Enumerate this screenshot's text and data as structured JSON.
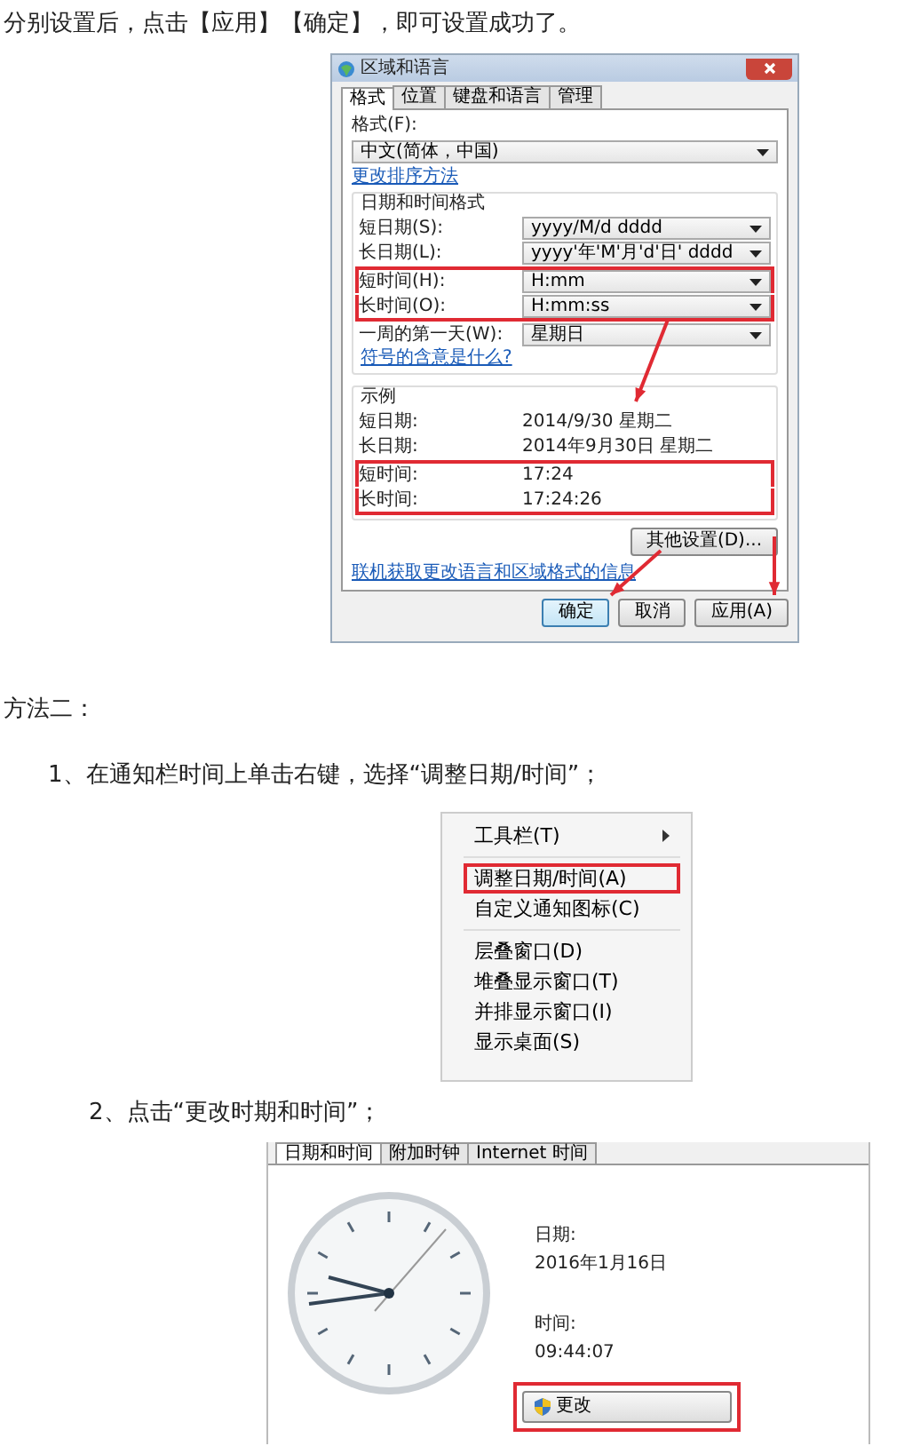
{
  "intro": "分别设置后，点击【应用】【确定】，即可设置成功了。",
  "region_dialog": {
    "title": "区域和语言",
    "tabs": [
      {
        "label": "格式",
        "selected": true
      },
      {
        "label": "位置",
        "selected": false
      },
      {
        "label": "键盘和语言",
        "selected": false
      },
      {
        "label": "管理",
        "selected": false
      }
    ],
    "format_label": "格式(F):",
    "format_value": "中文(简体，中国)",
    "sort_link": "更改排序方法",
    "datetime_group": {
      "title": "日期和时间格式",
      "rows": [
        {
          "label": "短日期(S):",
          "value": "yyyy/M/d dddd",
          "highlighted": false
        },
        {
          "label": "长日期(L):",
          "value": "yyyy'年'M'月'd'日' dddd",
          "highlighted": false
        },
        {
          "label": "短时间(H):",
          "value": "H:mm",
          "highlighted": true
        },
        {
          "label": "长时间(O):",
          "value": "H:mm:ss",
          "highlighted": true
        },
        {
          "label": "一周的第一天(W):",
          "value": "星期日",
          "highlighted": false
        }
      ]
    },
    "symbols_link": "符号的含意是什么?",
    "example_group": {
      "title": "示例",
      "rows": [
        {
          "label": "短日期:",
          "value": "2014/9/30 星期二",
          "highlighted": false
        },
        {
          "label": "长日期:",
          "value": "2014年9月30日 星期二",
          "highlighted": false
        },
        {
          "label": "短时间:",
          "value": "17:24",
          "highlighted": true
        },
        {
          "label": "长时间:",
          "value": "17:24:26",
          "highlighted": true
        }
      ]
    },
    "other_settings_button": "其他设置(D)...",
    "online_link": "联机获取更改语言和区域格式的信息",
    "buttons": [
      {
        "label": "确定",
        "default": true
      },
      {
        "label": "取消",
        "default": false
      },
      {
        "label": "应用(A)",
        "default": false
      }
    ]
  },
  "method_heading": "方法二：",
  "step_1": "1、在通知栏时间上单击右键，选择“调整日期/时间”；",
  "context_menu": {
    "items": [
      {
        "label": "工具栏(T)",
        "submenu": true,
        "highlighted": false,
        "separator_before": false
      },
      {
        "label": "调整日期/时间(A)",
        "submenu": false,
        "highlighted": true,
        "separator_before": true
      },
      {
        "label": "自定义通知图标(C)",
        "submenu": false,
        "highlighted": false,
        "separator_before": false
      },
      {
        "label": "层叠窗口(D)",
        "submenu": false,
        "highlighted": false,
        "separator_before": true
      },
      {
        "label": "堆叠显示窗口(T)",
        "submenu": false,
        "highlighted": false,
        "separator_before": false
      },
      {
        "label": "并排显示窗口(I)",
        "submenu": false,
        "highlighted": false,
        "separator_before": false
      },
      {
        "label": "显示桌面(S)",
        "submenu": false,
        "highlighted": false,
        "separator_before": false
      }
    ]
  },
  "step_2": "2、点击“更改时期和时间”；",
  "clock_dialog": {
    "tabs": [
      {
        "label": "日期和时间",
        "selected": true
      },
      {
        "label": "附加时钟",
        "selected": false
      },
      {
        "label": "Internet 时间",
        "selected": false
      }
    ],
    "date_label": "日期:",
    "date": "2016年1月16日",
    "time_label": "时间:",
    "time": "09:44:07",
    "change_button": {
      "label": "更改",
      "highlighted": true
    }
  }
}
